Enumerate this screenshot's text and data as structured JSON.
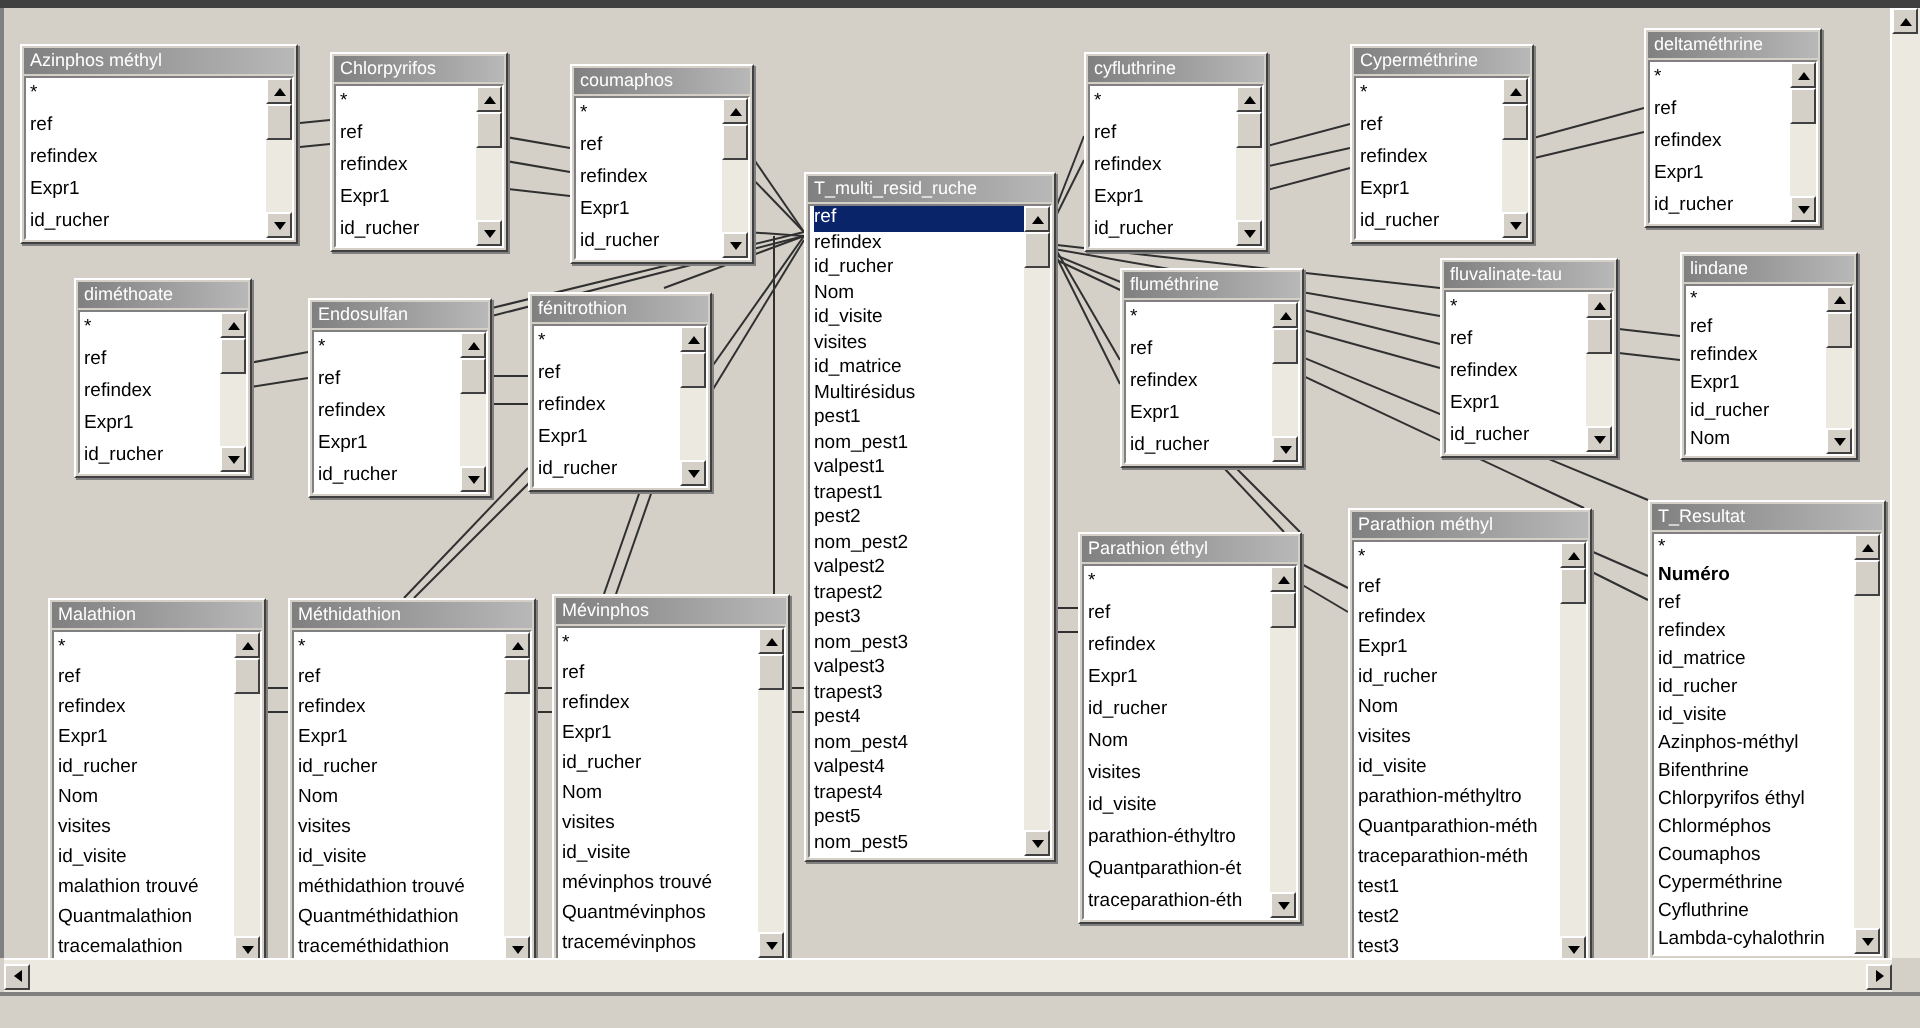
{
  "tables": [
    {
      "title": "Azinphos méthyl",
      "fields": [
        {
          "name": "*",
          "selected": false,
          "key": false
        },
        {
          "name": "ref",
          "selected": false,
          "key": false
        },
        {
          "name": "refindex",
          "selected": false,
          "key": false
        },
        {
          "name": "Expr1",
          "selected": false,
          "key": false
        },
        {
          "name": "id_rucher",
          "selected": false,
          "key": false
        }
      ]
    },
    {
      "title": "Chlorpyrifos",
      "fields": [
        {
          "name": "*",
          "selected": false,
          "key": false
        },
        {
          "name": "ref",
          "selected": false,
          "key": false
        },
        {
          "name": "refindex",
          "selected": false,
          "key": false
        },
        {
          "name": "Expr1",
          "selected": false,
          "key": false
        },
        {
          "name": "id_rucher",
          "selected": false,
          "key": false
        }
      ]
    },
    {
      "title": "coumaphos",
      "fields": [
        {
          "name": "*",
          "selected": false,
          "key": false
        },
        {
          "name": "ref",
          "selected": false,
          "key": false
        },
        {
          "name": "refindex",
          "selected": false,
          "key": false
        },
        {
          "name": "Expr1",
          "selected": false,
          "key": false
        },
        {
          "name": "id_rucher",
          "selected": false,
          "key": false
        }
      ]
    },
    {
      "title": "T_multi_resid_ruche",
      "fields": [
        {
          "name": "ref",
          "selected": true,
          "key": false
        },
        {
          "name": "refindex",
          "selected": false,
          "key": false
        },
        {
          "name": "id_rucher",
          "selected": false,
          "key": false
        },
        {
          "name": "Nom",
          "selected": false,
          "key": false
        },
        {
          "name": "id_visite",
          "selected": false,
          "key": false
        },
        {
          "name": "visites",
          "selected": false,
          "key": false
        },
        {
          "name": "id_matrice",
          "selected": false,
          "key": false
        },
        {
          "name": "Multirésidus",
          "selected": false,
          "key": false
        },
        {
          "name": "pest1",
          "selected": false,
          "key": false
        },
        {
          "name": "nom_pest1",
          "selected": false,
          "key": false
        },
        {
          "name": "valpest1",
          "selected": false,
          "key": false
        },
        {
          "name": "trapest1",
          "selected": false,
          "key": false
        },
        {
          "name": "pest2",
          "selected": false,
          "key": false
        },
        {
          "name": "nom_pest2",
          "selected": false,
          "key": false
        },
        {
          "name": "valpest2",
          "selected": false,
          "key": false
        },
        {
          "name": "trapest2",
          "selected": false,
          "key": false
        },
        {
          "name": "pest3",
          "selected": false,
          "key": false
        },
        {
          "name": "nom_pest3",
          "selected": false,
          "key": false
        },
        {
          "name": "valpest3",
          "selected": false,
          "key": false
        },
        {
          "name": "trapest3",
          "selected": false,
          "key": false
        },
        {
          "name": "pest4",
          "selected": false,
          "key": false
        },
        {
          "name": "nom_pest4",
          "selected": false,
          "key": false
        },
        {
          "name": "valpest4",
          "selected": false,
          "key": false
        },
        {
          "name": "trapest4",
          "selected": false,
          "key": false
        },
        {
          "name": "pest5",
          "selected": false,
          "key": false
        },
        {
          "name": "nom_pest5",
          "selected": false,
          "key": false
        }
      ]
    },
    {
      "title": "cyfluthrine",
      "fields": [
        {
          "name": "*",
          "selected": false,
          "key": false
        },
        {
          "name": "ref",
          "selected": false,
          "key": false
        },
        {
          "name": "refindex",
          "selected": false,
          "key": false
        },
        {
          "name": "Expr1",
          "selected": false,
          "key": false
        },
        {
          "name": "id_rucher",
          "selected": false,
          "key": false
        }
      ]
    },
    {
      "title": "Cyperméthrine",
      "fields": [
        {
          "name": "*",
          "selected": false,
          "key": false
        },
        {
          "name": "ref",
          "selected": false,
          "key": false
        },
        {
          "name": "refindex",
          "selected": false,
          "key": false
        },
        {
          "name": "Expr1",
          "selected": false,
          "key": false
        },
        {
          "name": "id_rucher",
          "selected": false,
          "key": false
        }
      ]
    },
    {
      "title": "deltaméthrine",
      "fields": [
        {
          "name": "*",
          "selected": false,
          "key": false
        },
        {
          "name": "ref",
          "selected": false,
          "key": false
        },
        {
          "name": "refindex",
          "selected": false,
          "key": false
        },
        {
          "name": "Expr1",
          "selected": false,
          "key": false
        },
        {
          "name": "id_rucher",
          "selected": false,
          "key": false
        }
      ]
    },
    {
      "title": "diméthoate",
      "fields": [
        {
          "name": "*",
          "selected": false,
          "key": false
        },
        {
          "name": "ref",
          "selected": false,
          "key": false
        },
        {
          "name": "refindex",
          "selected": false,
          "key": false
        },
        {
          "name": "Expr1",
          "selected": false,
          "key": false
        },
        {
          "name": "id_rucher",
          "selected": false,
          "key": false
        }
      ]
    },
    {
      "title": "Endosulfan",
      "fields": [
        {
          "name": "*",
          "selected": false,
          "key": false
        },
        {
          "name": "ref",
          "selected": false,
          "key": false
        },
        {
          "name": "refindex",
          "selected": false,
          "key": false
        },
        {
          "name": "Expr1",
          "selected": false,
          "key": false
        },
        {
          "name": "id_rucher",
          "selected": false,
          "key": false
        }
      ]
    },
    {
      "title": "fénitrothion",
      "fields": [
        {
          "name": "*",
          "selected": false,
          "key": false
        },
        {
          "name": "ref",
          "selected": false,
          "key": false
        },
        {
          "name": "refindex",
          "selected": false,
          "key": false
        },
        {
          "name": "Expr1",
          "selected": false,
          "key": false
        },
        {
          "name": "id_rucher",
          "selected": false,
          "key": false
        }
      ]
    },
    {
      "title": "fluméthrine",
      "fields": [
        {
          "name": "*",
          "selected": false,
          "key": false
        },
        {
          "name": "ref",
          "selected": false,
          "key": false
        },
        {
          "name": "refindex",
          "selected": false,
          "key": false
        },
        {
          "name": "Expr1",
          "selected": false,
          "key": false
        },
        {
          "name": "id_rucher",
          "selected": false,
          "key": false
        }
      ]
    },
    {
      "title": "fluvalinate-tau",
      "fields": [
        {
          "name": "*",
          "selected": false,
          "key": false
        },
        {
          "name": "ref",
          "selected": false,
          "key": false
        },
        {
          "name": "refindex",
          "selected": false,
          "key": false
        },
        {
          "name": "Expr1",
          "selected": false,
          "key": false
        },
        {
          "name": "id_rucher",
          "selected": false,
          "key": false
        }
      ]
    },
    {
      "title": "lindane",
      "fields": [
        {
          "name": "*",
          "selected": false,
          "key": false
        },
        {
          "name": "ref",
          "selected": false,
          "key": false
        },
        {
          "name": "refindex",
          "selected": false,
          "key": false
        },
        {
          "name": "Expr1",
          "selected": false,
          "key": false
        },
        {
          "name": "id_rucher",
          "selected": false,
          "key": false
        },
        {
          "name": "Nom",
          "selected": false,
          "key": false
        }
      ]
    },
    {
      "title": "Malathion",
      "fields": [
        {
          "name": "*",
          "selected": false,
          "key": false
        },
        {
          "name": "ref",
          "selected": false,
          "key": false
        },
        {
          "name": "refindex",
          "selected": false,
          "key": false
        },
        {
          "name": "Expr1",
          "selected": false,
          "key": false
        },
        {
          "name": "id_rucher",
          "selected": false,
          "key": false
        },
        {
          "name": "Nom",
          "selected": false,
          "key": false
        },
        {
          "name": "visites",
          "selected": false,
          "key": false
        },
        {
          "name": "id_visite",
          "selected": false,
          "key": false
        },
        {
          "name": "malathion trouvé",
          "selected": false,
          "key": false
        },
        {
          "name": "Quantmalathion",
          "selected": false,
          "key": false
        },
        {
          "name": "tracemalathion",
          "selected": false,
          "key": false
        }
      ]
    },
    {
      "title": "Méthidathion",
      "fields": [
        {
          "name": "*",
          "selected": false,
          "key": false
        },
        {
          "name": "ref",
          "selected": false,
          "key": false
        },
        {
          "name": "refindex",
          "selected": false,
          "key": false
        },
        {
          "name": "Expr1",
          "selected": false,
          "key": false
        },
        {
          "name": "id_rucher",
          "selected": false,
          "key": false
        },
        {
          "name": "Nom",
          "selected": false,
          "key": false
        },
        {
          "name": "visites",
          "selected": false,
          "key": false
        },
        {
          "name": "id_visite",
          "selected": false,
          "key": false
        },
        {
          "name": "méthidathion trouvé",
          "selected": false,
          "key": false
        },
        {
          "name": "Quantméthidathion",
          "selected": false,
          "key": false
        },
        {
          "name": "traceméthidathion",
          "selected": false,
          "key": false
        }
      ]
    },
    {
      "title": "Mévinphos",
      "fields": [
        {
          "name": "*",
          "selected": false,
          "key": false
        },
        {
          "name": "ref",
          "selected": false,
          "key": false
        },
        {
          "name": "refindex",
          "selected": false,
          "key": false
        },
        {
          "name": "Expr1",
          "selected": false,
          "key": false
        },
        {
          "name": "id_rucher",
          "selected": false,
          "key": false
        },
        {
          "name": "Nom",
          "selected": false,
          "key": false
        },
        {
          "name": "visites",
          "selected": false,
          "key": false
        },
        {
          "name": "id_visite",
          "selected": false,
          "key": false
        },
        {
          "name": "mévinphos trouvé",
          "selected": false,
          "key": false
        },
        {
          "name": "Quantmévinphos",
          "selected": false,
          "key": false
        },
        {
          "name": "tracemévinphos",
          "selected": false,
          "key": false
        }
      ]
    },
    {
      "title": "Parathion éthyl",
      "fields": [
        {
          "name": "*",
          "selected": false,
          "key": false
        },
        {
          "name": "ref",
          "selected": false,
          "key": false
        },
        {
          "name": "refindex",
          "selected": false,
          "key": false
        },
        {
          "name": "Expr1",
          "selected": false,
          "key": false
        },
        {
          "name": "id_rucher",
          "selected": false,
          "key": false
        },
        {
          "name": "Nom",
          "selected": false,
          "key": false
        },
        {
          "name": "visites",
          "selected": false,
          "key": false
        },
        {
          "name": "id_visite",
          "selected": false,
          "key": false
        },
        {
          "name": "parathion-éthyltro",
          "selected": false,
          "key": false
        },
        {
          "name": "Quantparathion-ét",
          "selected": false,
          "key": false
        },
        {
          "name": "traceparathion-éth",
          "selected": false,
          "key": false
        }
      ]
    },
    {
      "title": "Parathion méthyl",
      "fields": [
        {
          "name": "*",
          "selected": false,
          "key": false
        },
        {
          "name": "ref",
          "selected": false,
          "key": false
        },
        {
          "name": "refindex",
          "selected": false,
          "key": false
        },
        {
          "name": "Expr1",
          "selected": false,
          "key": false
        },
        {
          "name": "id_rucher",
          "selected": false,
          "key": false
        },
        {
          "name": "Nom",
          "selected": false,
          "key": false
        },
        {
          "name": "visites",
          "selected": false,
          "key": false
        },
        {
          "name": "id_visite",
          "selected": false,
          "key": false
        },
        {
          "name": "parathion-méthyltro",
          "selected": false,
          "key": false
        },
        {
          "name": "Quantparathion-méth",
          "selected": false,
          "key": false
        },
        {
          "name": "traceparathion-méth",
          "selected": false,
          "key": false
        },
        {
          "name": "test1",
          "selected": false,
          "key": false
        },
        {
          "name": "test2",
          "selected": false,
          "key": false
        },
        {
          "name": "test3",
          "selected": false,
          "key": false
        }
      ]
    },
    {
      "title": "T_Resultat",
      "fields": [
        {
          "name": "*",
          "selected": false,
          "key": false
        },
        {
          "name": "Numéro",
          "selected": false,
          "key": true
        },
        {
          "name": "ref",
          "selected": false,
          "key": false
        },
        {
          "name": "refindex",
          "selected": false,
          "key": false
        },
        {
          "name": "id_matrice",
          "selected": false,
          "key": false
        },
        {
          "name": "id_rucher",
          "selected": false,
          "key": false
        },
        {
          "name": "id_visite",
          "selected": false,
          "key": false
        },
        {
          "name": "Azinphos-méthyl",
          "selected": false,
          "key": false
        },
        {
          "name": "Bifenthrine",
          "selected": false,
          "key": false
        },
        {
          "name": "Chlorpyrifos éthyl",
          "selected": false,
          "key": false
        },
        {
          "name": "Chlorméphos",
          "selected": false,
          "key": false
        },
        {
          "name": "Coumaphos",
          "selected": false,
          "key": false
        },
        {
          "name": "Cyperméthrine",
          "selected": false,
          "key": false
        },
        {
          "name": "Cyfluthrine",
          "selected": false,
          "key": false
        },
        {
          "name": "Lambda-cyhalothrin",
          "selected": false,
          "key": false
        }
      ]
    }
  ]
}
